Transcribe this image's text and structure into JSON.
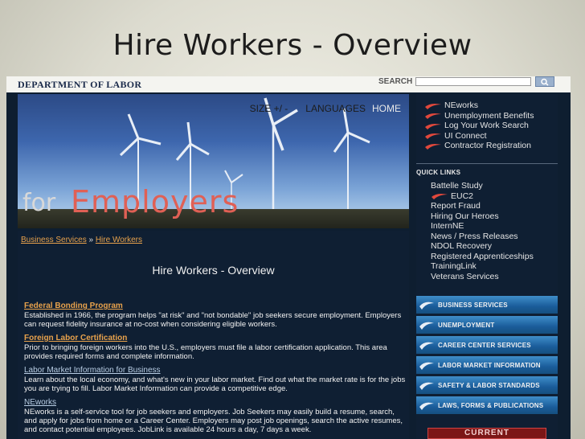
{
  "slide": {
    "title": "Hire Workers - Overview"
  },
  "header": {
    "dept": "DEPARTMENT OF LABOR",
    "search_label": "SEARCH",
    "search_value": ""
  },
  "hero": {
    "nav": {
      "size": "SIZE +/ -",
      "languages": "LANGUAGES",
      "home": "HOME"
    },
    "for_text": "for",
    "employers_text": "Employers"
  },
  "breadcrumb": {
    "link1": "Business Services",
    "sep": " » ",
    "link2": "Hire Workers"
  },
  "page_heading": "Hire Workers - Overview",
  "items": [
    {
      "title": "Federal Bonding Program",
      "desc": "Established in 1966, the program helps \"at risk\" and \"not bondable\" job seekers secure employment. Employers can request fidelity insurance at no-cost when considering eligible workers."
    },
    {
      "title": "Foreign Labor Certification",
      "desc": "Prior to bringing foreign workers into the U.S., employers must file a labor certification application. This area provides required forms and complete information."
    },
    {
      "title": "Labor Market Information for Business",
      "desc": "Learn about the local economy, and what's new in your labor market. Find out what the market rate is for the jobs you are trying to fill. Labor Market Information can provide a competitive edge."
    },
    {
      "title": "NEworks",
      "desc": "NEworks is a self-service tool for job seekers and employers. Job Seekers may easily build a resume, search, and apply for jobs from home or a Career Center. Employers may post job openings, search the active resumes, and contact potential employees. JobLink is available 24 hours a day, 7 days a week."
    }
  ],
  "sidebar": {
    "top_links": [
      "NEworks",
      "Unemployment Benefits",
      "Log Your Work Search",
      "UI Connect",
      "Contractor Registration"
    ],
    "quick_links_heading": "QUICK LINKS",
    "quick_links": [
      "Battelle Study",
      "EUC2",
      "Report Fraud",
      "Hiring Our Heroes",
      "InternNE",
      "News / Press Releases",
      "NDOL Recovery",
      "Registered Apprenticeships",
      "TrainingLink",
      "Veterans Services"
    ],
    "categories": [
      "BUSINESS SERVICES",
      "UNEMPLOYMENT",
      "CAREER CENTER SERVICES",
      "LABOR MARKET INFORMATION",
      "SAFETY & LABOR STANDARDS",
      "LAWS, FORMS & PUBLICATIONS"
    ],
    "current_label": "CURRENT"
  },
  "colors": {
    "accent_orange": "#e8a24c",
    "brand_red": "#e06055",
    "nav_blue": "#1a5c9a",
    "page_bg": "#0f1f33"
  }
}
